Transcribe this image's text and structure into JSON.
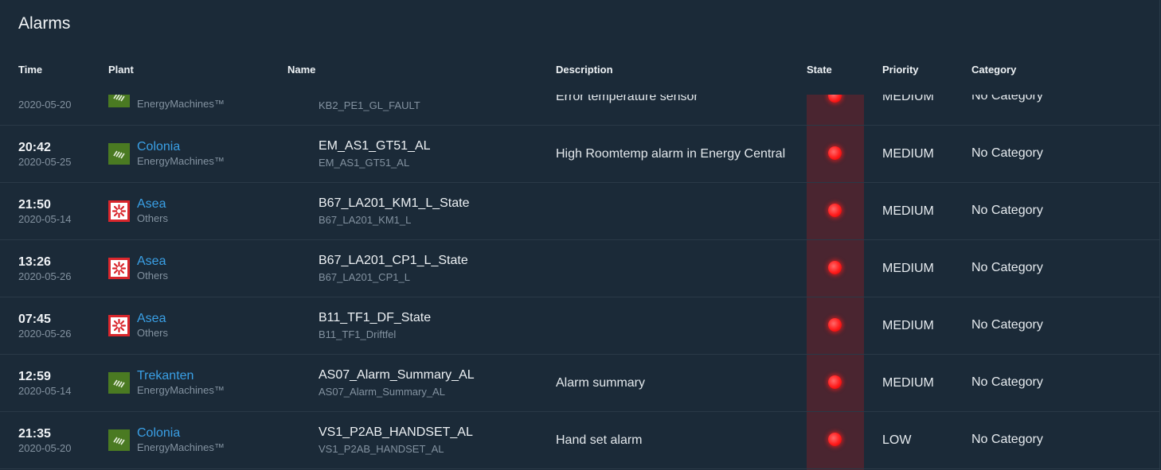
{
  "title": "Alarms",
  "columns": {
    "time": "Time",
    "plant": "Plant",
    "name": "Name",
    "description": "Description",
    "state": "State",
    "priority": "Priority",
    "category": "Category"
  },
  "colors": {
    "background": "#1b2a38",
    "link": "#3aa0e6",
    "state_active": "#ff1c1c",
    "state_column": "#4a2530"
  },
  "rows": [
    {
      "time": "",
      "date": "2020-05-20",
      "plant": "",
      "plant_type": "EnergyMachines™",
      "plant_logo": "energymachines-logo",
      "name": "",
      "name_sub": "KB2_PE1_GL_FAULT",
      "description": "Error temperature sensor",
      "state": "active",
      "priority": "MEDIUM",
      "category": "No Category"
    },
    {
      "time": "20:42",
      "date": "2020-05-25",
      "plant": "Colonia",
      "plant_type": "EnergyMachines™",
      "plant_logo": "energymachines-logo",
      "name": "EM_AS1_GT51_AL",
      "name_sub": "EM_AS1_GT51_AL",
      "description": "High Roomtemp alarm in Energy Central",
      "state": "active",
      "priority": "MEDIUM",
      "category": "No Category"
    },
    {
      "time": "21:50",
      "date": "2020-05-14",
      "plant": "Asea",
      "plant_type": "Others",
      "plant_logo": "asea-logo",
      "name": "B67_LA201_KM1_L_State",
      "name_sub": "B67_LA201_KM1_L",
      "description": "",
      "state": "active",
      "priority": "MEDIUM",
      "category": "No Category"
    },
    {
      "time": "13:26",
      "date": "2020-05-26",
      "plant": "Asea",
      "plant_type": "Others",
      "plant_logo": "asea-logo",
      "name": "B67_LA201_CP1_L_State",
      "name_sub": "B67_LA201_CP1_L",
      "description": "",
      "state": "active",
      "priority": "MEDIUM",
      "category": "No Category"
    },
    {
      "time": "07:45",
      "date": "2020-05-26",
      "plant": "Asea",
      "plant_type": "Others",
      "plant_logo": "asea-logo",
      "name": "B11_TF1_DF_State",
      "name_sub": "B11_TF1_Driftfel",
      "description": "",
      "state": "active",
      "priority": "MEDIUM",
      "category": "No Category"
    },
    {
      "time": "12:59",
      "date": "2020-05-14",
      "plant": "Trekanten",
      "plant_type": "EnergyMachines™",
      "plant_logo": "energymachines-logo",
      "name": "AS07_Alarm_Summary_AL",
      "name_sub": "AS07_Alarm_Summary_AL",
      "description": "Alarm summary",
      "state": "active",
      "priority": "MEDIUM",
      "category": "No Category"
    },
    {
      "time": "21:35",
      "date": "2020-05-20",
      "plant": "Colonia",
      "plant_type": "EnergyMachines™",
      "plant_logo": "energymachines-logo",
      "name": "VS1_P2AB_HANDSET_AL",
      "name_sub": "VS1_P2AB_HANDSET_AL",
      "description": "Hand set alarm",
      "state": "active",
      "priority": "LOW",
      "category": "No Category"
    }
  ]
}
